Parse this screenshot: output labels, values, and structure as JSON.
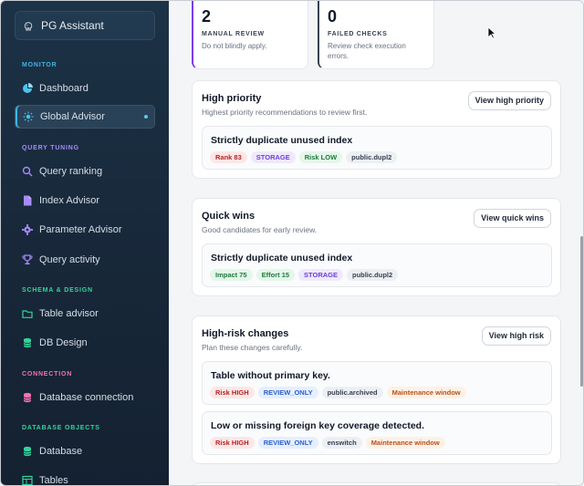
{
  "brand": {
    "title": "PG Assistant"
  },
  "colors": {
    "sidebar_bg": "#18293b",
    "accent": "#3fb5e6",
    "manual_review_accent": "#7c3aed",
    "failed_checks_accent": "#374151"
  },
  "sidebar": {
    "sections": [
      {
        "label": "MONITOR",
        "color": "#3fb5e6",
        "items": [
          {
            "label": "Dashboard",
            "icon": "pie-chart-icon"
          },
          {
            "label": "Global Advisor",
            "icon": "sparkle-icon",
            "active": true
          }
        ]
      },
      {
        "label": "QUERY TUNING",
        "color": "#a78bfa",
        "items": [
          {
            "label": "Query ranking",
            "icon": "ranking-search-icon"
          },
          {
            "label": "Index Advisor",
            "icon": "document-icon"
          },
          {
            "label": "Parameter Advisor",
            "icon": "gear-icon"
          },
          {
            "label": "Query activity",
            "icon": "trophy-icon"
          }
        ]
      },
      {
        "label": "SCHEMA & DESIGN",
        "color": "#34d399",
        "items": [
          {
            "label": "Table advisor",
            "icon": "folder-icon"
          },
          {
            "label": "DB Design",
            "icon": "database-icon"
          }
        ]
      },
      {
        "label": "CONNECTION",
        "color": "#f472b6",
        "items": [
          {
            "label": "Database connection",
            "icon": "database-connection-icon"
          }
        ]
      },
      {
        "label": "DATABASE OBJECTS",
        "color": "#34d399",
        "items": [
          {
            "label": "Database",
            "icon": "database-icon"
          },
          {
            "label": "Tables",
            "icon": "table-icon"
          }
        ]
      }
    ]
  },
  "stats": [
    {
      "value": "2",
      "label": "MANUAL REVIEW",
      "desc": "Do not blindly apply."
    },
    {
      "value": "0",
      "label": "FAILED CHECKS",
      "desc": "Review check execution errors."
    }
  ],
  "cards": [
    {
      "title": "High priority",
      "subtitle": "Highest priority recommendations to review first.",
      "button": "View high priority",
      "items": [
        {
          "title": "Strictly duplicate unused index",
          "tags": [
            {
              "text": "Rank 83",
              "style": "red"
            },
            {
              "text": "STORAGE",
              "style": "purple"
            },
            {
              "text": "Risk LOW",
              "style": "green"
            },
            {
              "text": "public.dupl2",
              "style": "gray"
            }
          ]
        }
      ]
    },
    {
      "title": "Quick wins",
      "subtitle": "Good candidates for early review.",
      "button": "View quick wins",
      "items": [
        {
          "title": "Strictly duplicate unused index",
          "tags": [
            {
              "text": "Impact 75",
              "style": "green"
            },
            {
              "text": "Effort 15",
              "style": "green"
            },
            {
              "text": "STORAGE",
              "style": "purple"
            },
            {
              "text": "public.dupl2",
              "style": "gray"
            }
          ]
        }
      ]
    },
    {
      "title": "High-risk changes",
      "subtitle": "Plan these changes carefully.",
      "button": "View high risk",
      "items": [
        {
          "title": "Table without primary key.",
          "tags": [
            {
              "text": "Risk HIGH",
              "style": "red"
            },
            {
              "text": "REVIEW_ONLY",
              "style": "blue"
            },
            {
              "text": "public.archived",
              "style": "gray"
            },
            {
              "text": "Maintenance window",
              "style": "orange"
            }
          ]
        },
        {
          "title": "Low or missing foreign key coverage detected.",
          "tags": [
            {
              "text": "Risk HIGH",
              "style": "red"
            },
            {
              "text": "REVIEW_ONLY",
              "style": "blue"
            },
            {
              "text": "enswitch",
              "style": "gray"
            },
            {
              "text": "Maintenance window",
              "style": "orange"
            }
          ]
        }
      ]
    }
  ]
}
